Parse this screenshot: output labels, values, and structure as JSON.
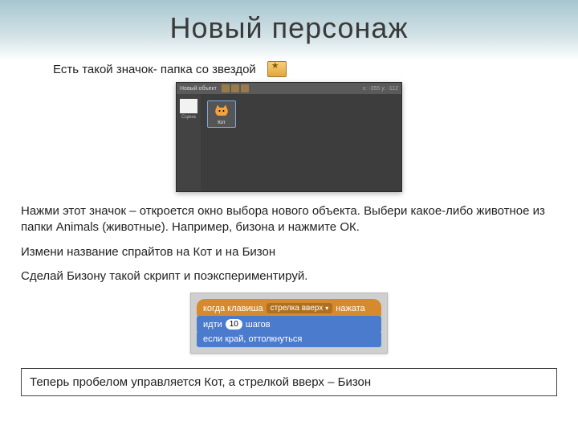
{
  "title": "Новый персонаж",
  "intro": "Есть такой значок- папка со звездой",
  "graybox": {
    "header_label": "Новый объект",
    "coords": "x: -355  y: -112",
    "stage_label": "Сцена",
    "sprite_label": "Кот"
  },
  "p1": "Нажми этот значок – откроется окно выбора нового объекта. Выбери какое-либо животное  из папки Animals (животные). Например, бизона и  нажмите ОК.",
  "p2": "Измени название спрайтов на Кот и на Бизон",
  "p3": "Сделай Бизону такой скрипт и поэкспериментируй.",
  "script": {
    "hat_pre": "когда клавиша",
    "hat_drop": "стрелка вверх",
    "hat_post": "нажата",
    "move_pre": "идти",
    "move_num": "10",
    "move_post": "шагов",
    "bounce": "если край, оттолкнуться"
  },
  "footer": "Теперь пробелом управляется Кот, а стрелкой вверх – Бизон"
}
